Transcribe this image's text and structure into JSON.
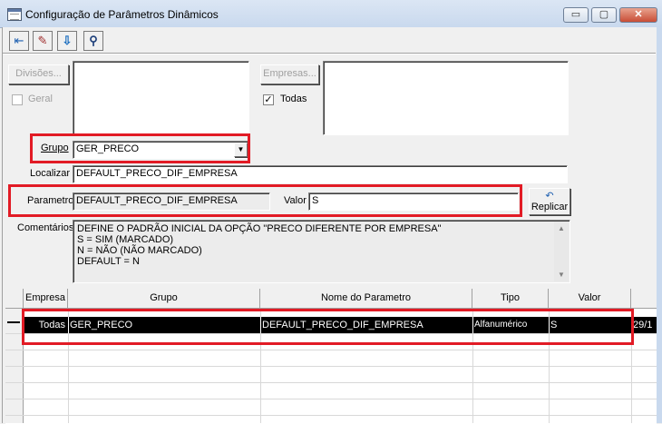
{
  "window": {
    "title": "Configuração de Parâmetros Dinâmicos",
    "controls": {
      "minimize": "▭",
      "maximize": "▢",
      "close": "✕"
    }
  },
  "toolbar": {
    "buttons": [
      {
        "name": "exit-icon",
        "glyph": "⇤"
      },
      {
        "name": "eraser-icon",
        "glyph": "✎"
      },
      {
        "name": "save-icon",
        "glyph": "⇩"
      },
      {
        "name": "binoculars-icon",
        "glyph": "⚲"
      }
    ]
  },
  "form": {
    "divisoes_button": "Divisões...",
    "geral_label": "Geral",
    "empresas_button": "Empresas...",
    "todas_label": "Todas",
    "todas_checked": "✓",
    "grupo_label": "Grupo",
    "grupo_value": "GER_PRECO",
    "localizar_label": "Localizar",
    "localizar_value": "DEFAULT_PRECO_DIF_EMPRESA",
    "parametro_label": "Parametro",
    "parametro_value": "DEFAULT_PRECO_DIF_EMPRESA",
    "valor_label": "Valor",
    "valor_value": "S",
    "replicar_button": "Replicar",
    "comentarios_label": "Comentários",
    "comentarios_lines": [
      "DEFINE O PADRÃO INICIAL DA OPÇÃO \"PRECO DIFERENTE POR EMPRESA\"",
      "S = SIM (MARCADO)",
      "N = NÃO (NÃO MARCADO)",
      "DEFAULT = N"
    ]
  },
  "grid": {
    "columns": [
      "Empresa",
      "Grupo",
      "Nome do Parametro",
      "Tipo",
      "Valor"
    ],
    "selected_row": {
      "empresa": "Todas",
      "grupo": "GER_PRECO",
      "nome": "DEFAULT_PRECO_DIF_EMPRESA",
      "tipo": "Alfanumérico",
      "valor": "S",
      "extra": "29/1"
    }
  },
  "colors": {
    "highlight_red": "#e21b25",
    "selected_row": "#000000",
    "window_bg": "#f0f0f0"
  }
}
